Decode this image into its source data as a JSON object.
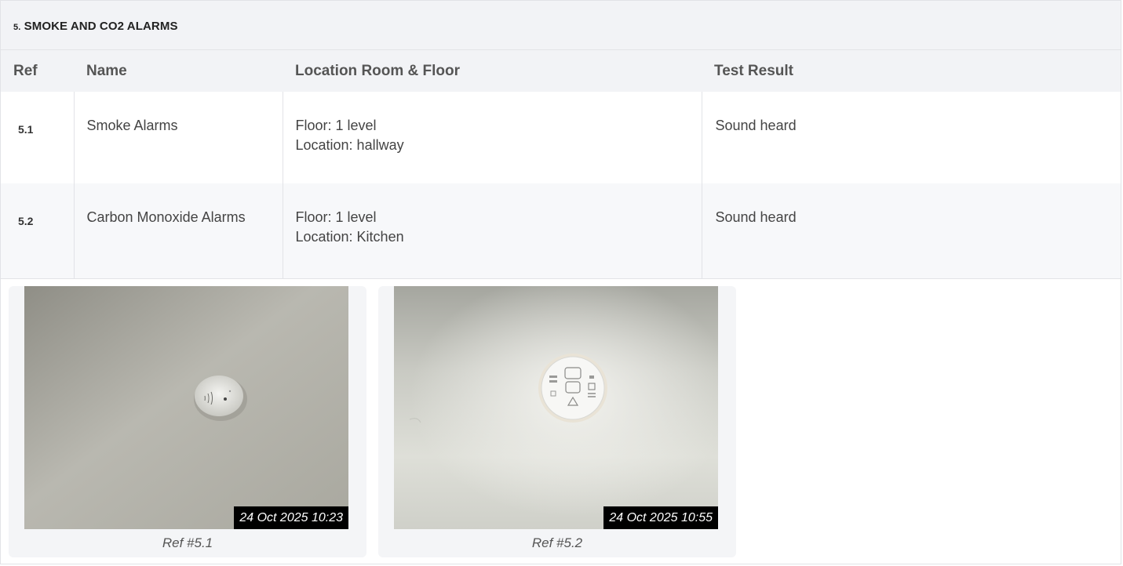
{
  "section": {
    "number": "5.",
    "title": "SMOKE AND CO2 ALARMS"
  },
  "table": {
    "headers": [
      "Ref",
      "Name",
      "Location Room & Floor",
      "Test Result"
    ],
    "rows": [
      {
        "ref": "5.1",
        "name": "Smoke Alarms",
        "floor": "Floor: 1 level",
        "location": "Location: hallway",
        "result": "Sound heard"
      },
      {
        "ref": "5.2",
        "name": "Carbon Monoxide Alarms",
        "floor": "Floor: 1 level",
        "location": "Location: Kitchen",
        "result": "Sound heard"
      }
    ]
  },
  "photos": [
    {
      "timestamp": "24 Oct 2025 10:23",
      "caption": "Ref #5.1"
    },
    {
      "timestamp": "24 Oct 2025 10:55",
      "caption": "Ref #5.2"
    }
  ],
  "colors": {
    "header_bg": "#f2f3f6",
    "border": "#e2e3e7",
    "stamp_bg": "#000000"
  }
}
